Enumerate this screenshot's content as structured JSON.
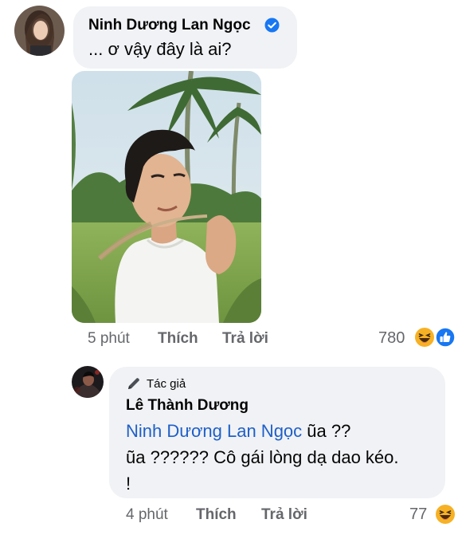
{
  "comment1": {
    "author": "Ninh Dương Lan Ngọc",
    "verified_icon": "verified-badge-icon",
    "text": "... ơ vậy đây là ai?",
    "photo_icon": "attached-photo",
    "time": "5 phút",
    "like_label": "Thích",
    "reply_label": "Trả lời",
    "reaction_count": "780",
    "reaction_icons": [
      "haha-reaction-icon",
      "like-reaction-icon"
    ]
  },
  "reply1": {
    "author_badge_icon": "pen-icon",
    "author_badge": "Tác giả",
    "author": "Lê Thành Dương",
    "mention": "Ninh Dương Lan Ngọc",
    "line1_after_mention": " ũa ??",
    "line2": "ũa ?????? Cô gái lòng dạ dao kéo.",
    "line3": "!",
    "time": "4 phút",
    "like_label": "Thích",
    "reply_label": "Trả lời",
    "reaction_count": "77",
    "reaction_icons": [
      "haha-reaction-icon"
    ]
  },
  "colors": {
    "bubble": "#f0f2f5",
    "secondary_text": "#65676b",
    "mention": "#1f5fc9",
    "verified": "#1877f2",
    "haha": "#f7b125"
  }
}
